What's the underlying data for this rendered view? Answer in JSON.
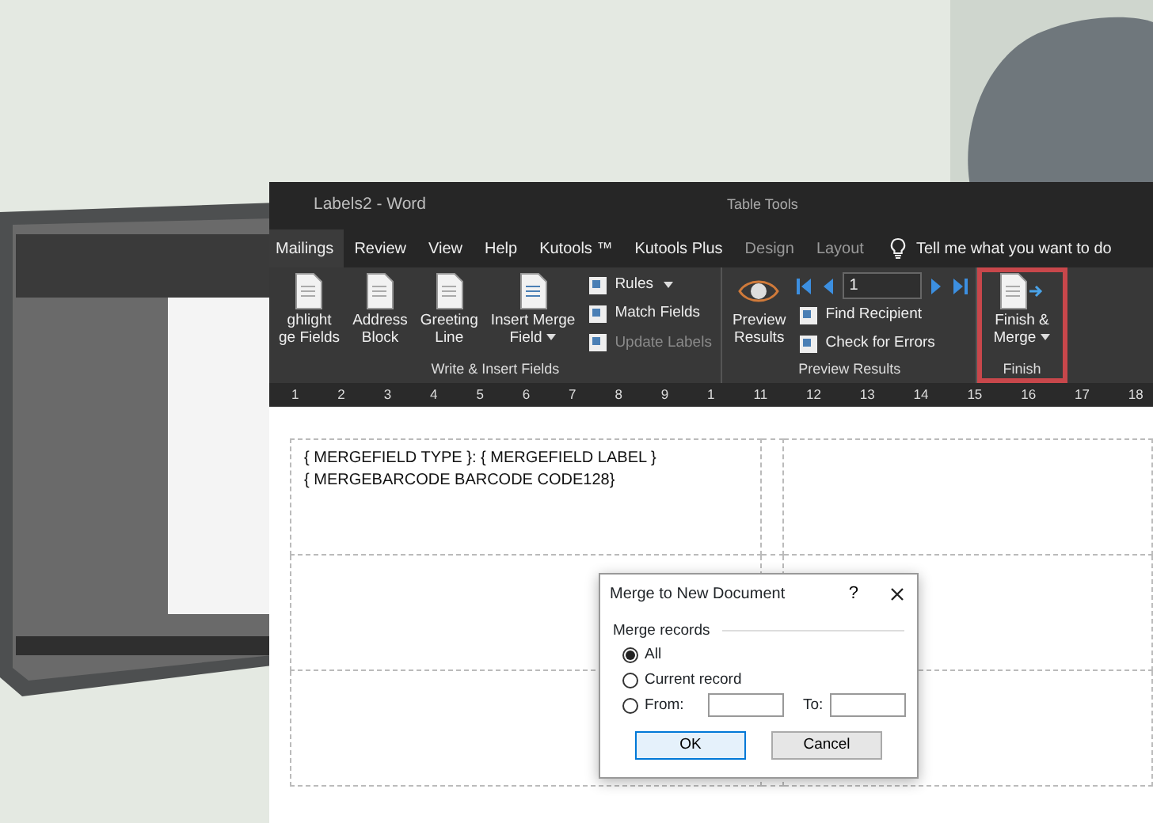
{
  "window": {
    "title": "Labels2  -  Word",
    "context_title": "Table Tools"
  },
  "tabs": [
    {
      "label": "Mailings",
      "selected": true,
      "kind": "normal"
    },
    {
      "label": "Review",
      "selected": false,
      "kind": "normal"
    },
    {
      "label": "View",
      "selected": false,
      "kind": "normal"
    },
    {
      "label": "Help",
      "selected": false,
      "kind": "normal"
    },
    {
      "label": "Kutools ™",
      "selected": false,
      "kind": "normal"
    },
    {
      "label": "Kutools Plus",
      "selected": false,
      "kind": "normal"
    },
    {
      "label": "Design",
      "selected": false,
      "kind": "context"
    },
    {
      "label": "Layout",
      "selected": false,
      "kind": "context"
    }
  ],
  "tell_me": "Tell me what you want to do",
  "ribbon": [
    {
      "label": "Write & Insert Fields",
      "highlighted": false,
      "items": [
        {
          "kind": "large",
          "lines": [
            "ghlight",
            "ge Fields"
          ],
          "dropdown": false,
          "disabled": false
        },
        {
          "kind": "large",
          "lines": [
            "Address",
            "Block"
          ],
          "dropdown": false,
          "disabled": false
        },
        {
          "kind": "large",
          "lines": [
            "Greeting",
            "Line"
          ],
          "dropdown": false,
          "disabled": false
        },
        {
          "kind": "large",
          "lines": [
            "Insert Merge",
            "Field"
          ],
          "dropdown": true,
          "disabled": false
        },
        {
          "kind": "small",
          "lines": [
            "Rules"
          ],
          "dropdown": true,
          "disabled": false
        },
        {
          "kind": "small",
          "lines": [
            "Match Fields"
          ],
          "dropdown": false,
          "disabled": false
        },
        {
          "kind": "small",
          "lines": [
            "Update Labels"
          ],
          "dropdown": false,
          "disabled": true
        }
      ]
    },
    {
      "label": "Preview Results",
      "highlighted": false,
      "items": [
        {
          "kind": "large",
          "lines": [
            "Preview",
            "Results"
          ],
          "dropdown": false,
          "disabled": false
        },
        {
          "kind": "nav",
          "record": "1"
        },
        {
          "kind": "small",
          "lines": [
            "Find Recipient"
          ],
          "dropdown": false,
          "disabled": false
        },
        {
          "kind": "small",
          "lines": [
            "Check for Errors"
          ],
          "dropdown": false,
          "disabled": false
        }
      ]
    },
    {
      "label": "Finish",
      "highlighted": true,
      "items": [
        {
          "kind": "large",
          "lines": [
            "Finish &",
            "Merge"
          ],
          "dropdown": true,
          "disabled": false
        }
      ]
    }
  ],
  "ruler": [
    "1",
    "2",
    "3",
    "4",
    "5",
    "6",
    "7",
    "8",
    "9",
    "1",
    "11",
    "12",
    "13",
    "14",
    "15",
    "16",
    "17",
    "18"
  ],
  "document": {
    "lines": [
      "{ MERGEFIELD TYPE }: { MERGEFIELD LABEL }",
      "{ MERGEBARCODE BARCODE CODE128}"
    ]
  },
  "dialog": {
    "title": "Merge to New Document",
    "help": "?",
    "section": "Merge records",
    "options": [
      {
        "label": "All",
        "selected": true
      },
      {
        "label": "Current record",
        "selected": false
      },
      {
        "label": "From:",
        "selected": false
      }
    ],
    "to_label": "To:",
    "buttons": [
      {
        "label": "OK",
        "kind": "default"
      },
      {
        "label": "Cancel",
        "kind": "normal"
      }
    ]
  }
}
